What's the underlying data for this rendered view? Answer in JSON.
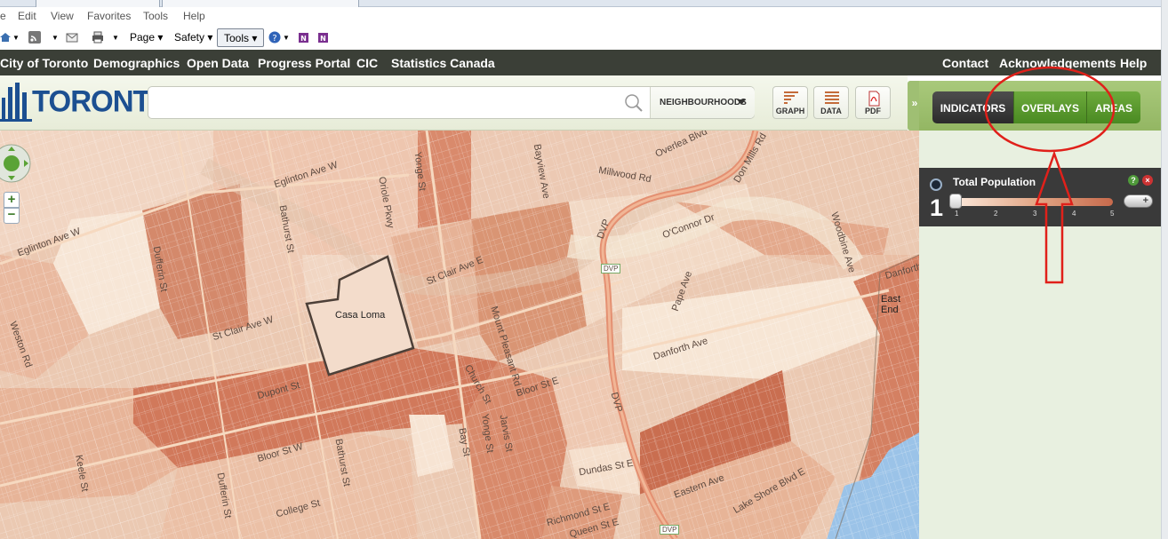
{
  "browser": {
    "menu": [
      "e",
      "Edit",
      "View",
      "Favorites",
      "Tools",
      "Help"
    ],
    "commands": {
      "page": "Page",
      "safety": "Safety",
      "tools": "Tools"
    }
  },
  "site_nav": {
    "left": [
      "City of Toronto",
      "Demographics",
      "Open Data",
      "Progress Portal",
      "CIC",
      "Statistics Canada"
    ],
    "right": [
      "Contact",
      "Acknowledgements",
      "Help"
    ]
  },
  "header": {
    "logo_text": "TORONTO",
    "search": {
      "value": "",
      "placeholder": ""
    },
    "area_dropdown": "NEIGHBOURHOODS",
    "buttons": {
      "graph": "GRAPH",
      "data": "DATA",
      "pdf": "PDF"
    }
  },
  "map": {
    "highlighted_area": "Casa Loma",
    "partial_label": "East End",
    "zoom_in": "+",
    "zoom_out": "−",
    "streets": [
      "Eglinton Ave W",
      "Eglinton Ave W",
      "Oriole Pkwy",
      "Yonge St",
      "Bathurst St",
      "Dufferin St",
      "St Clair Ave W",
      "St Clair Ave E",
      "Weston Rd",
      "Dupont St",
      "Bloor St W",
      "Bathurst St",
      "Dufferin St",
      "Keele St",
      "College St",
      "Bay St",
      "Yonge St",
      "Jarvis St",
      "Church St",
      "Mount Pleasant Rd",
      "Bloor St E",
      "Bayview Ave",
      "Millwood Rd",
      "Overlea Blvd",
      "Don Mills Rd",
      "O'Connor Dr",
      "Pape Ave",
      "Woodbine Ave",
      "Danforth Ave",
      "DVP",
      "DVP",
      "DVP",
      "Dundas St E",
      "Eastern Ave",
      "Lake Shore Blvd E",
      "Richmond St E",
      "Queen St E",
      "Danforth Ave",
      "DVP"
    ]
  },
  "panel": {
    "toggle": "»",
    "tabs": {
      "indicators": "INDICATORS",
      "overlays": "OVERLAYS",
      "areas": "AREAS"
    },
    "indicator": {
      "title": "Total Population",
      "help": "?",
      "close": "×",
      "value": "1",
      "ticks": [
        "1",
        "2",
        "3",
        "4",
        "5"
      ],
      "opacity_symbol": "+"
    }
  },
  "colors": {
    "nav_bg": "#3b3f37",
    "logo_blue": "#1c4f91",
    "tab_active": "#2b2b2b",
    "tab_green": "#5a9a2e",
    "annotation_red": "#e0201a",
    "choropleth_light": "#f6e2cf",
    "choropleth_dark": "#c7694c"
  }
}
